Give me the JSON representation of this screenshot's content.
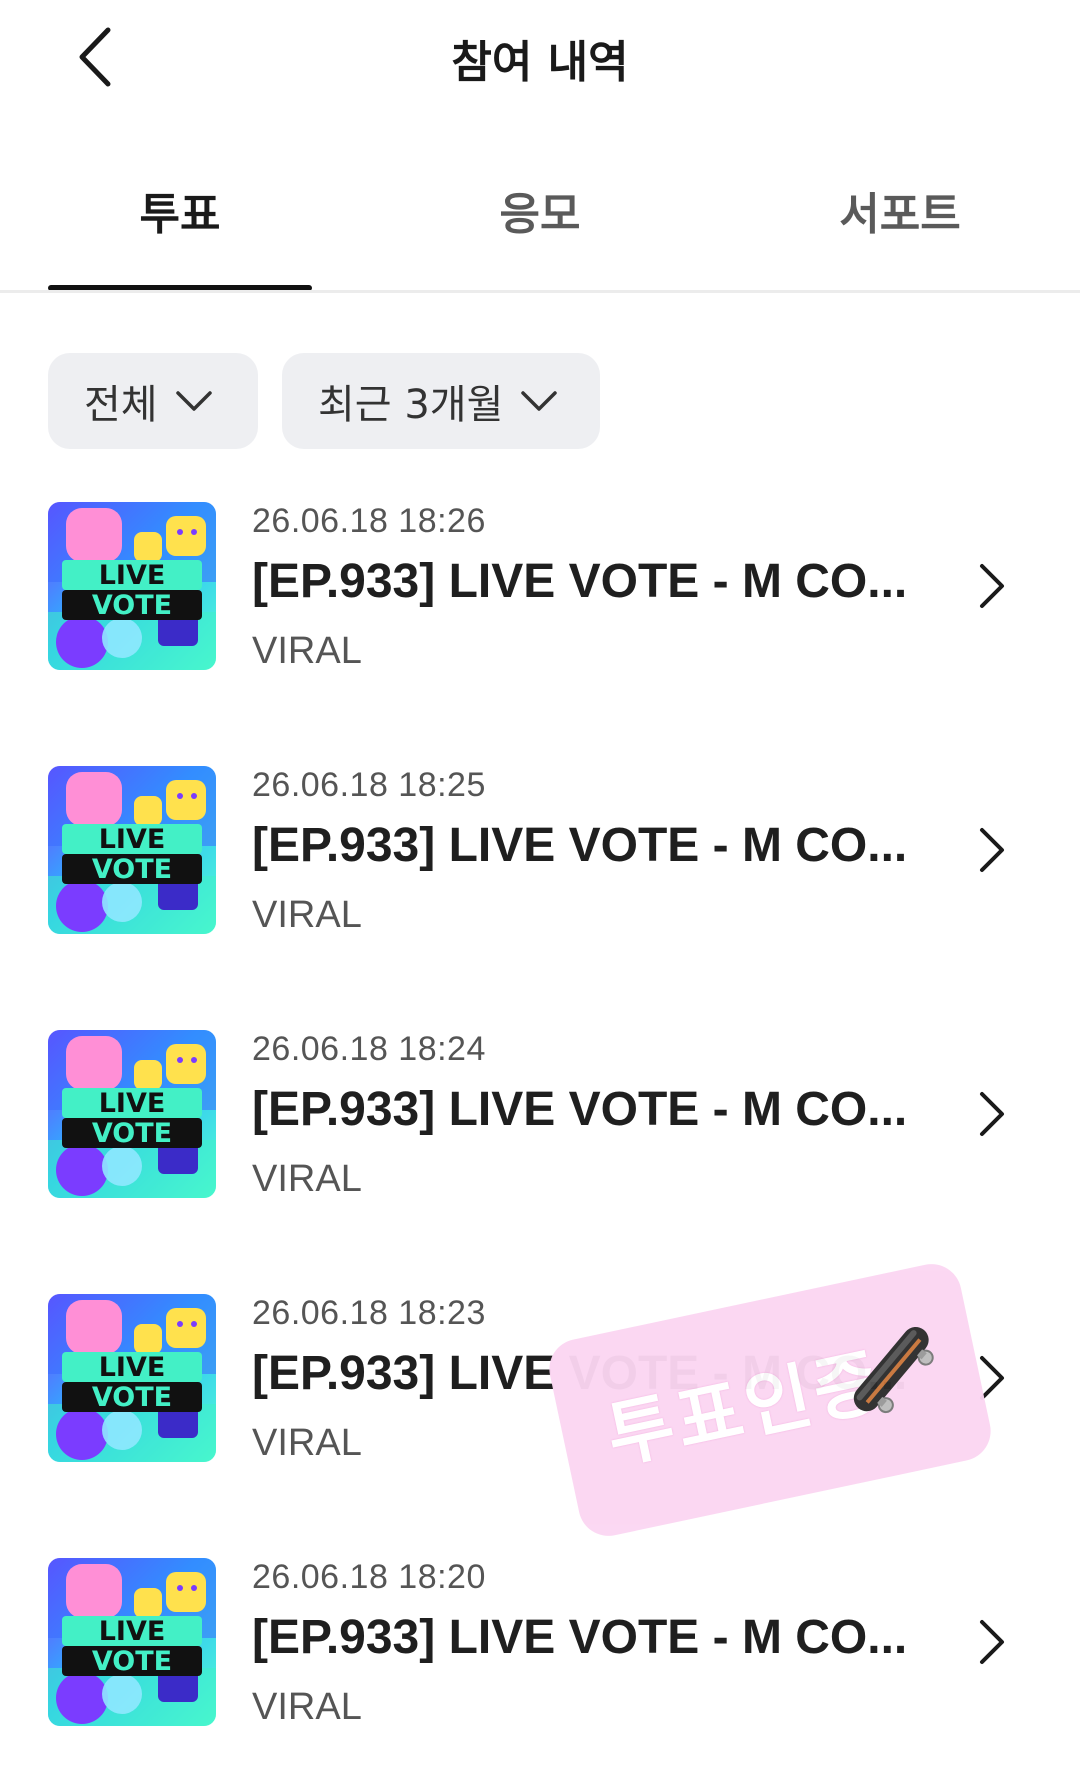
{
  "header": {
    "title": "참여 내역",
    "back_icon": "chevron-left-icon"
  },
  "tabs": [
    {
      "label": "투표",
      "active": true
    },
    {
      "label": "응모",
      "active": false
    },
    {
      "label": "서포트",
      "active": false
    }
  ],
  "filters": {
    "category": "전체",
    "period": "최근 3개월"
  },
  "thumbnail": {
    "line1": "LIVE",
    "line2": "VOTE"
  },
  "items": [
    {
      "date": "26.06.18 18:26",
      "title": "[EP.933] LIVE VOTE - M CO...",
      "subtitle": "VIRAL"
    },
    {
      "date": "26.06.18 18:25",
      "title": "[EP.933] LIVE VOTE - M CO...",
      "subtitle": "VIRAL"
    },
    {
      "date": "26.06.18 18:24",
      "title": "[EP.933] LIVE VOTE - M CO...",
      "subtitle": "VIRAL"
    },
    {
      "date": "26.06.18 18:23",
      "title": "[EP.933] LIVE VOTE - M CO...",
      "subtitle": "VIRAL"
    },
    {
      "date": "26.06.18 18:20",
      "title": "[EP.933] LIVE VOTE - M CO...",
      "subtitle": "VIRAL"
    }
  ],
  "sticker": {
    "text": "투표인증",
    "icon": "skateboard-icon"
  },
  "colors": {
    "active_tab": "#1a1a1a",
    "inactive_tab": "#5a5a5a",
    "filter_bg": "#eeeff2",
    "sticker_bg": "#fbd6f2"
  }
}
